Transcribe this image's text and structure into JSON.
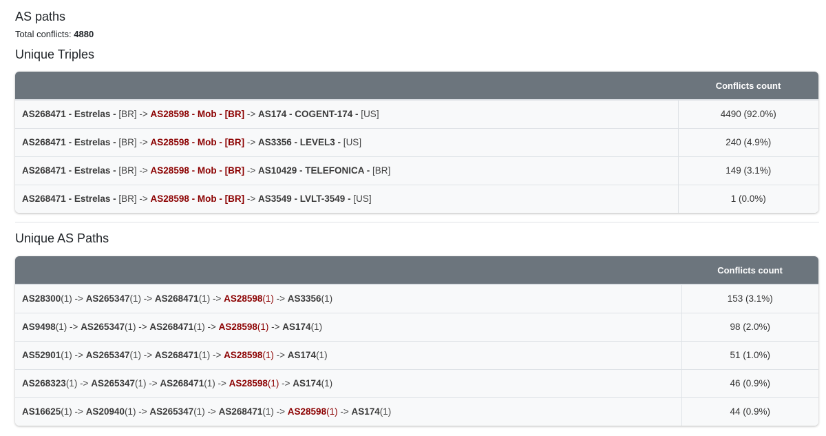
{
  "page": {
    "title": "AS paths",
    "total_conflicts_label": "Total conflicts:",
    "total_conflicts_value": "4880"
  },
  "colors": {
    "header_bg": "#6c757d",
    "highlight_as": "#8b0000",
    "row_bg": "#f8f9fa"
  },
  "triples": {
    "title": "Unique Triples",
    "columns": [
      "",
      "Conflicts count"
    ],
    "rows": [
      {
        "hops": [
          {
            "asn": "AS268471",
            "name": "Estrelas",
            "cc": "BR",
            "highlight": false
          },
          {
            "asn": "AS28598",
            "name": "Mob",
            "cc": "BR",
            "highlight": true
          },
          {
            "asn": "AS174",
            "name": "COGENT-174",
            "cc": "US",
            "highlight": false
          }
        ],
        "count": "4490 (92.0%)"
      },
      {
        "hops": [
          {
            "asn": "AS268471",
            "name": "Estrelas",
            "cc": "BR",
            "highlight": false
          },
          {
            "asn": "AS28598",
            "name": "Mob",
            "cc": "BR",
            "highlight": true
          },
          {
            "asn": "AS3356",
            "name": "LEVEL3",
            "cc": "US",
            "highlight": false
          }
        ],
        "count": "240 (4.9%)"
      },
      {
        "hops": [
          {
            "asn": "AS268471",
            "name": "Estrelas",
            "cc": "BR",
            "highlight": false
          },
          {
            "asn": "AS28598",
            "name": "Mob",
            "cc": "BR",
            "highlight": true
          },
          {
            "asn": "AS10429",
            "name": "TELEFONICA",
            "cc": "BR",
            "highlight": false
          }
        ],
        "count": "149 (3.1%)"
      },
      {
        "hops": [
          {
            "asn": "AS268471",
            "name": "Estrelas",
            "cc": "BR",
            "highlight": false
          },
          {
            "asn": "AS28598",
            "name": "Mob",
            "cc": "BR",
            "highlight": true
          },
          {
            "asn": "AS3549",
            "name": "LVLT-3549",
            "cc": "US",
            "highlight": false
          }
        ],
        "count": "1 (0.0%)"
      }
    ]
  },
  "paths": {
    "title": "Unique AS Paths",
    "columns": [
      "",
      "Conflicts count"
    ],
    "rows": [
      {
        "hops": [
          {
            "asn": "AS28300",
            "rep": "(1)",
            "highlight": false
          },
          {
            "asn": "AS265347",
            "rep": "(1)",
            "highlight": false
          },
          {
            "asn": "AS268471",
            "rep": "(1)",
            "highlight": false
          },
          {
            "asn": "AS28598",
            "rep": "(1)",
            "highlight": true
          },
          {
            "asn": "AS3356",
            "rep": "(1)",
            "highlight": false
          }
        ],
        "count": "153 (3.1%)"
      },
      {
        "hops": [
          {
            "asn": "AS9498",
            "rep": "(1)",
            "highlight": false
          },
          {
            "asn": "AS265347",
            "rep": "(1)",
            "highlight": false
          },
          {
            "asn": "AS268471",
            "rep": "(1)",
            "highlight": false
          },
          {
            "asn": "AS28598",
            "rep": "(1)",
            "highlight": true
          },
          {
            "asn": "AS174",
            "rep": "(1)",
            "highlight": false
          }
        ],
        "count": "98 (2.0%)"
      },
      {
        "hops": [
          {
            "asn": "AS52901",
            "rep": "(1)",
            "highlight": false
          },
          {
            "asn": "AS265347",
            "rep": "(1)",
            "highlight": false
          },
          {
            "asn": "AS268471",
            "rep": "(1)",
            "highlight": false
          },
          {
            "asn": "AS28598",
            "rep": "(1)",
            "highlight": true
          },
          {
            "asn": "AS174",
            "rep": "(1)",
            "highlight": false
          }
        ],
        "count": "51 (1.0%)"
      },
      {
        "hops": [
          {
            "asn": "AS268323",
            "rep": "(1)",
            "highlight": false
          },
          {
            "asn": "AS265347",
            "rep": "(1)",
            "highlight": false
          },
          {
            "asn": "AS268471",
            "rep": "(1)",
            "highlight": false
          },
          {
            "asn": "AS28598",
            "rep": "(1)",
            "highlight": true
          },
          {
            "asn": "AS174",
            "rep": "(1)",
            "highlight": false
          }
        ],
        "count": "46 (0.9%)"
      },
      {
        "hops": [
          {
            "asn": "AS16625",
            "rep": "(1)",
            "highlight": false
          },
          {
            "asn": "AS20940",
            "rep": "(1)",
            "highlight": false
          },
          {
            "asn": "AS265347",
            "rep": "(1)",
            "highlight": false
          },
          {
            "asn": "AS268471",
            "rep": "(1)",
            "highlight": false
          },
          {
            "asn": "AS28598",
            "rep": "(1)",
            "highlight": true
          },
          {
            "asn": "AS174",
            "rep": "(1)",
            "highlight": false
          }
        ],
        "count": "44 (0.9%)"
      }
    ]
  }
}
